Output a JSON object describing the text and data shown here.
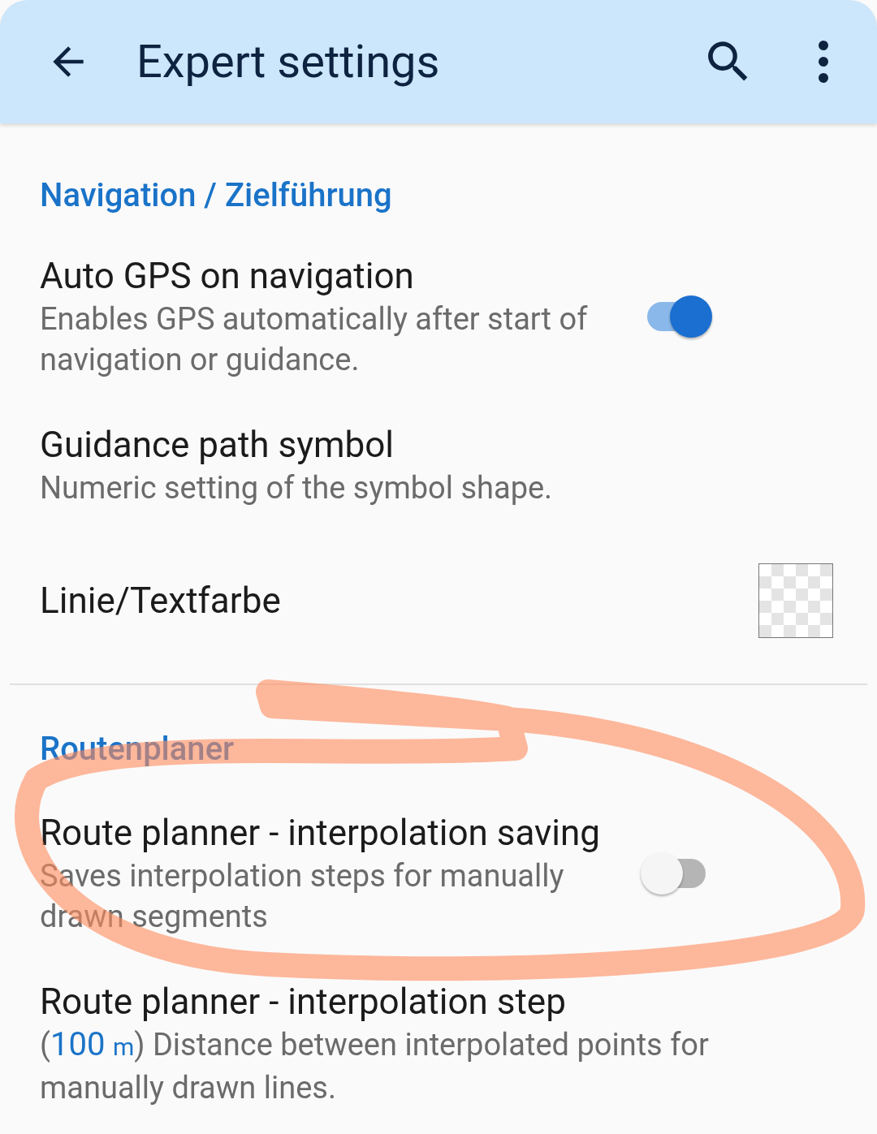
{
  "app_bar": {
    "title": "Expert settings"
  },
  "sections": [
    {
      "title": "Navigation / Zielführung",
      "items": [
        {
          "kind": "switch",
          "title": "Auto GPS on navigation",
          "summary": "Enables GPS automatically after start of navigation or guidance.",
          "on": true
        },
        {
          "kind": "plain",
          "title": "Guidance path symbol",
          "summary": "Numeric setting of the symbol shape."
        },
        {
          "kind": "color",
          "title": "Linie/Textfarbe"
        }
      ]
    },
    {
      "title": "Routenplaner",
      "items": [
        {
          "kind": "switch",
          "title": "Route planner - interpolation saving",
          "summary": "Saves interpolation steps for manually drawn segments",
          "on": false
        },
        {
          "kind": "value",
          "title": "Route planner - interpolation step",
          "value_open": "(",
          "value": "100",
          "unit": "m",
          "value_close": ")",
          "summary": "Distance between interpolated points for manually drawn lines."
        }
      ]
    }
  ]
}
